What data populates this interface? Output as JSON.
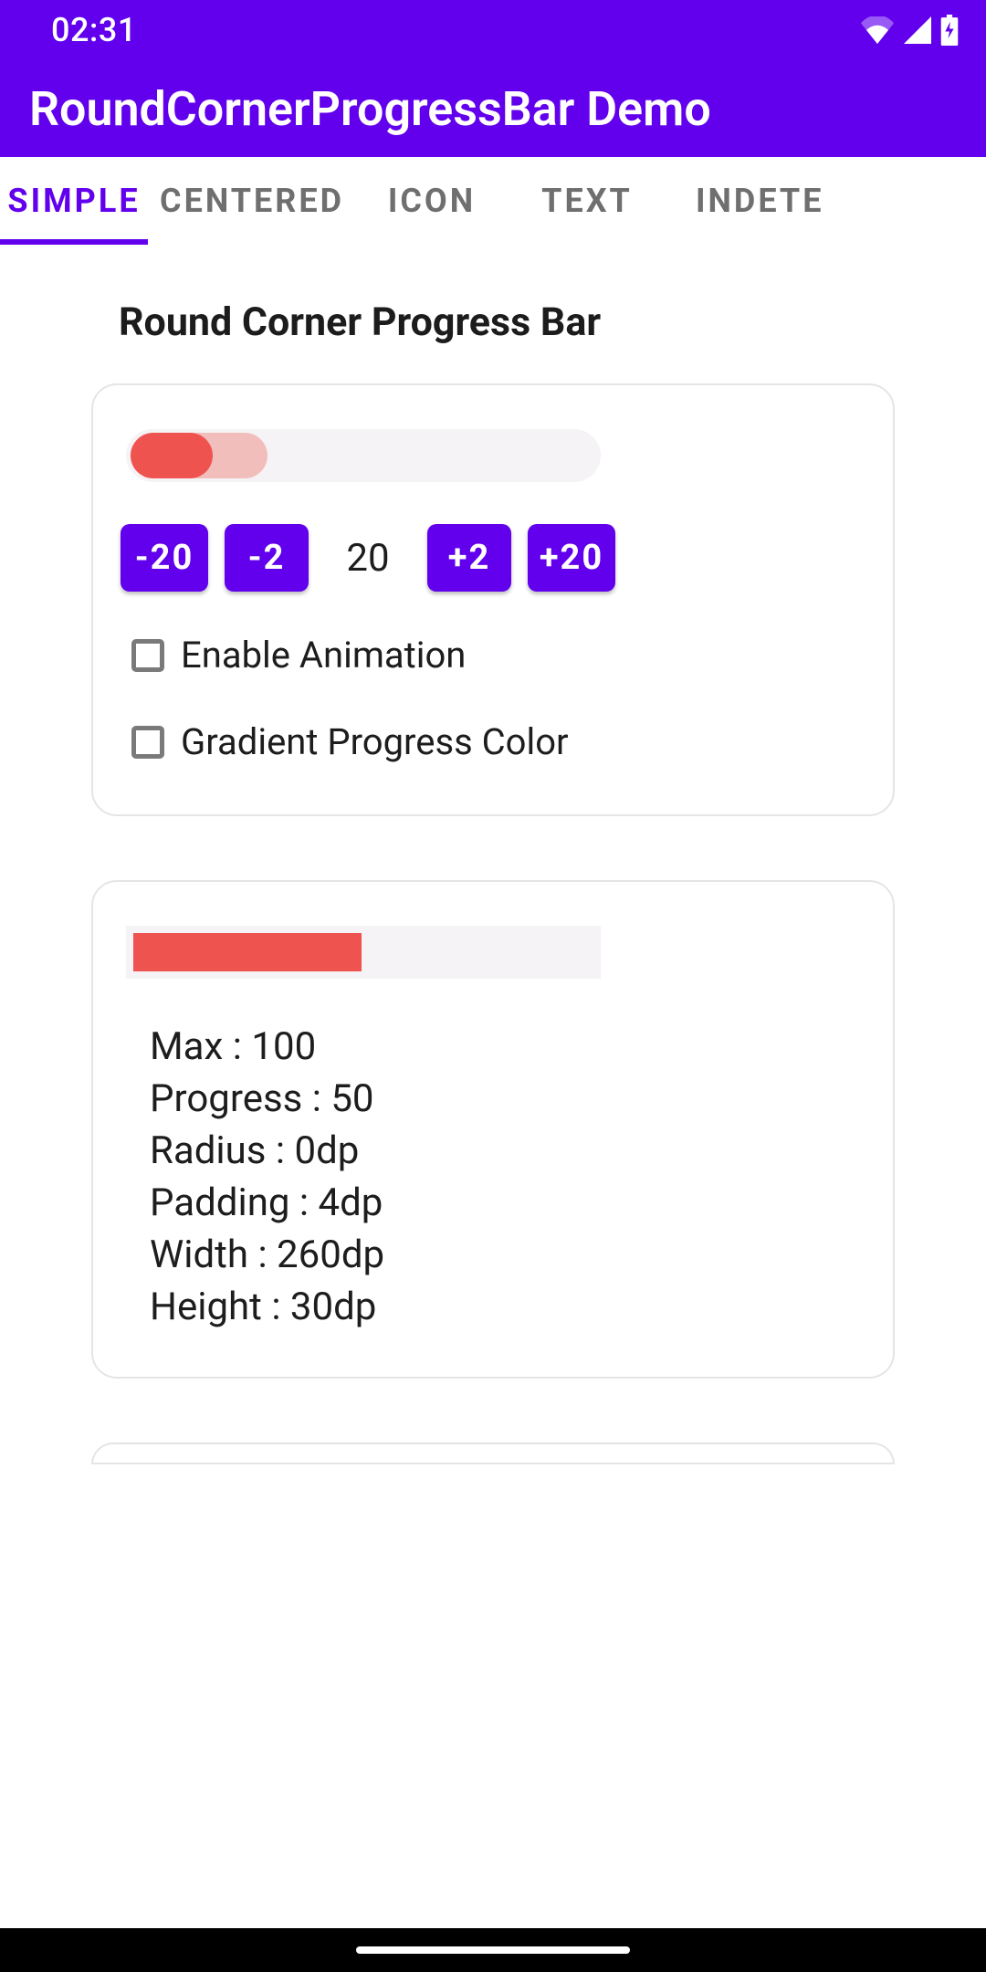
{
  "status": {
    "time": "02:31"
  },
  "app": {
    "title": "RoundCornerProgressBar Demo"
  },
  "tabs": {
    "t0": "SIMPLE",
    "t1": "CENTERED",
    "t2": "ICON",
    "t3": "TEXT",
    "t4": "INDETE"
  },
  "section": {
    "heading": "Round Corner Progress Bar"
  },
  "card1": {
    "btn_minus20": "-20",
    "btn_minus2": "-2",
    "value": "20",
    "btn_plus2": "+2",
    "btn_plus20": "+20",
    "check1": "Enable Animation",
    "check2": "Gradient Progress Color"
  },
  "card2": {
    "max": "Max : 100",
    "progress": "Progress : 50",
    "radius": "Radius : 0dp",
    "padding": "Padding : 4dp",
    "width": "Width : 260dp",
    "height": "Height : 30dp"
  }
}
